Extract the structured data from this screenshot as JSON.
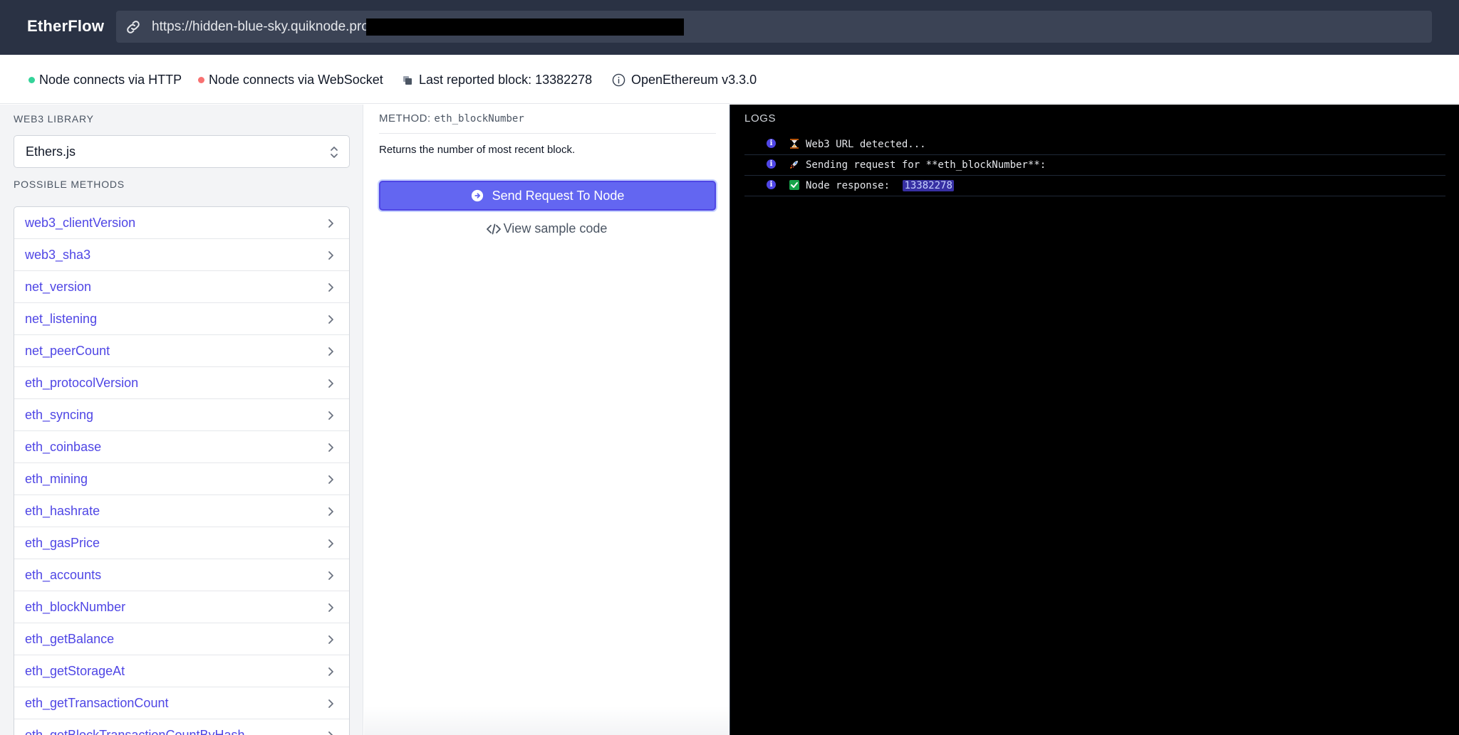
{
  "header": {
    "brand": "EtherFlow",
    "url_text": "https://hidden-blue-sky.quiknode.pro/"
  },
  "status": {
    "http_label": "Node connects via HTTP",
    "http_color": "#34d399",
    "ws_label": "Node connects via WebSocket",
    "ws_color": "#f87171",
    "block_label": "Last reported block: 13382278",
    "client_label": "OpenEthereum v3.3.0"
  },
  "sidebar": {
    "library_label": "WEB3 LIBRARY",
    "library_value": "Ethers.js",
    "methods_label": "POSSIBLE METHODS",
    "methods": [
      "web3_clientVersion",
      "web3_sha3",
      "net_version",
      "net_listening",
      "net_peerCount",
      "eth_protocolVersion",
      "eth_syncing",
      "eth_coinbase",
      "eth_mining",
      "eth_hashrate",
      "eth_gasPrice",
      "eth_accounts",
      "eth_blockNumber",
      "eth_getBalance",
      "eth_getStorageAt",
      "eth_getTransactionCount",
      "eth_getBlockTransactionCountByHash"
    ]
  },
  "method_panel": {
    "title_prefix": "METHOD:",
    "title_method": "eth_blockNumber",
    "description": "Returns the number of most recent block.",
    "send_label": "Send Request To Node",
    "sample_label": "View sample code"
  },
  "logs": {
    "title": "LOGS",
    "entries": [
      {
        "icon": "hourglass-icon",
        "text": "Web3 URL detected..."
      },
      {
        "icon": "rocket-icon",
        "text": "Sending request for **eth_blockNumber**:"
      },
      {
        "icon": "check-mark-icon",
        "text": "Node response: ",
        "value": "13382278"
      }
    ]
  },
  "colors": {
    "accent": "#4f46e5",
    "button": "#6366f1",
    "header_bg": "#2a3244"
  }
}
